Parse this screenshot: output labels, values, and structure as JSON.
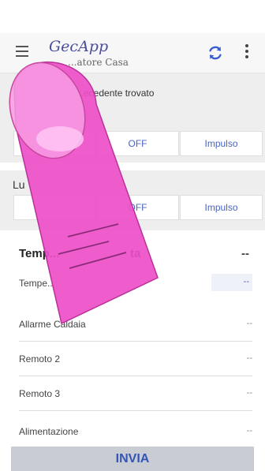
{
  "app": {
    "title": "GecApp",
    "subtitle": "...atore Casa"
  },
  "status": {
    "text": "...ecedente trovato"
  },
  "row1": {
    "off": "OFF",
    "pulse": "Impulso"
  },
  "section2": {
    "label": "Lu",
    "off": "OFF",
    "pulse": "Impulso"
  },
  "temperature": {
    "title": "Temp...",
    "title_tail": "ta",
    "value_dash": "--",
    "row_label": "Tempe...",
    "row_value": "--"
  },
  "rows": [
    {
      "label": "Allarme Caldaia",
      "value": "--"
    },
    {
      "label": "Remoto 2",
      "value": "--"
    },
    {
      "label": "Remoto 3",
      "value": "--"
    },
    {
      "label": "Alimentazione",
      "value": "--"
    }
  ],
  "actions": {
    "send": "INVIA"
  },
  "colors": {
    "accent": "#4a64c0",
    "finger": "#ee4fc9"
  }
}
